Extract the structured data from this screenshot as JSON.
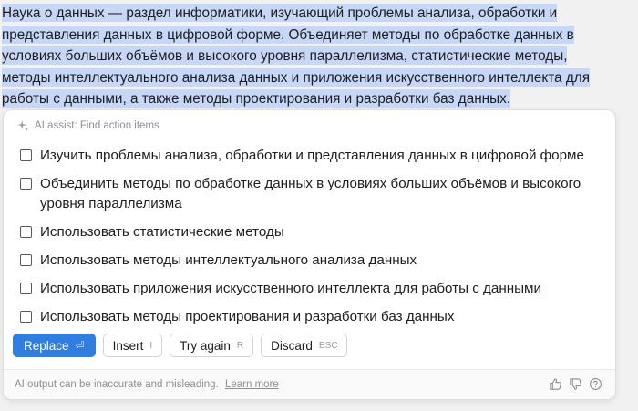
{
  "paragraph": {
    "lines": [
      "Наука о данных — раздел информатики, изучающий проблемы анализа, обработки и",
      "представления данных в цифровой форме. Объединяет методы по обработке данных в",
      "условиях больших объёмов и высокого уровня параллелизма, статистические методы,",
      "методы интеллектуального анализа данных и приложения искусственного интеллекта для",
      "работы с данными, а также методы проектирования и разработки баз данных."
    ]
  },
  "assist": {
    "header": "AI assist: Find action items",
    "header_icon": "sparkle-icon",
    "items": [
      {
        "text": "Изучить проблемы анализа, обработки и представления данных в цифровой форме",
        "checked": false
      },
      {
        "text": "Объединить методы по обработке данных в условиях больших объёмов и высокого уровня параллелизма",
        "checked": false
      },
      {
        "text": "Использовать статистические методы",
        "checked": false
      },
      {
        "text": "Использовать методы интеллектуального анализа данных",
        "checked": false
      },
      {
        "text": "Использовать приложения искусственного интеллекта для работы с данными",
        "checked": false
      },
      {
        "text": "Использовать методы проектирования и разработки баз данных",
        "checked": false
      }
    ],
    "buttons": {
      "replace": {
        "label": "Replace",
        "key": "⏎"
      },
      "insert": {
        "label": "Insert",
        "key": "I"
      },
      "try_again": {
        "label": "Try again",
        "key": "R"
      },
      "discard": {
        "label": "Discard",
        "key": "ESC"
      }
    },
    "footer": {
      "disclaimer": "AI output can be inaccurate and misleading.",
      "learn_more": "Learn more",
      "icons": [
        "thumbs-up-icon",
        "thumbs-down-icon",
        "help-icon"
      ]
    }
  },
  "colors": {
    "accent": "#2f7ee0",
    "selection": "#c7d7f7",
    "background": "#f1f1f1"
  }
}
